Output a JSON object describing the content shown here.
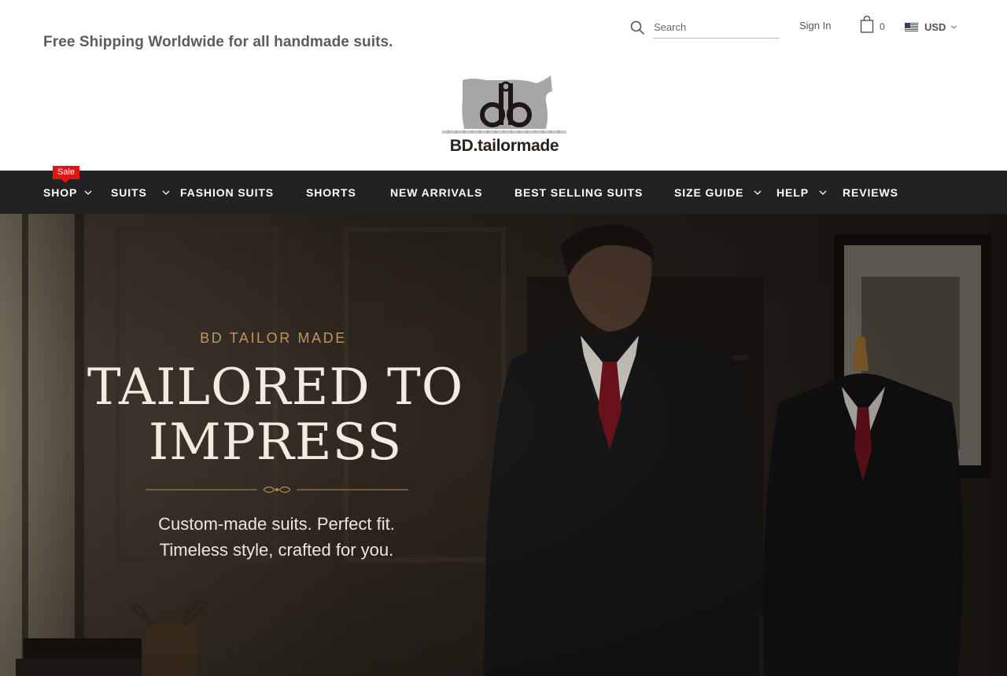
{
  "header": {
    "promo_text": "Free Shipping Worldwide for all handmade suits.",
    "search": {
      "placeholder": "Search",
      "value": ""
    },
    "sign_in_label": "Sign In",
    "cart_count": "0",
    "currency": "USD",
    "logo_text": "BD.tailormade"
  },
  "nav": {
    "sale_badge": "Sale",
    "items": [
      {
        "label": "SHOP",
        "has_dropdown": true
      },
      {
        "label": "SUITS",
        "has_dropdown": true
      },
      {
        "label": "FASHION SUITS",
        "has_dropdown": false
      },
      {
        "label": "SHORTS",
        "has_dropdown": false
      },
      {
        "label": "NEW ARRIVALS",
        "has_dropdown": false
      },
      {
        "label": "BEST SELLING SUITS",
        "has_dropdown": false
      },
      {
        "label": "SIZE GUIDE",
        "has_dropdown": true
      },
      {
        "label": "HELP",
        "has_dropdown": true
      },
      {
        "label": "REVIEWS",
        "has_dropdown": false
      }
    ]
  },
  "hero": {
    "eyebrow": "BD TAILOR MADE",
    "headline": "TAILORED TO IMPRESS",
    "subtitle_line1": "Custom-made suits. Perfect fit.",
    "subtitle_line2": "Timeless style, crafted for you."
  },
  "colors": {
    "nav_bg": "#222222",
    "sale_red": "#e3160f",
    "eyebrow_gold": "#c39460",
    "hero_text": "#f1ebe0"
  }
}
